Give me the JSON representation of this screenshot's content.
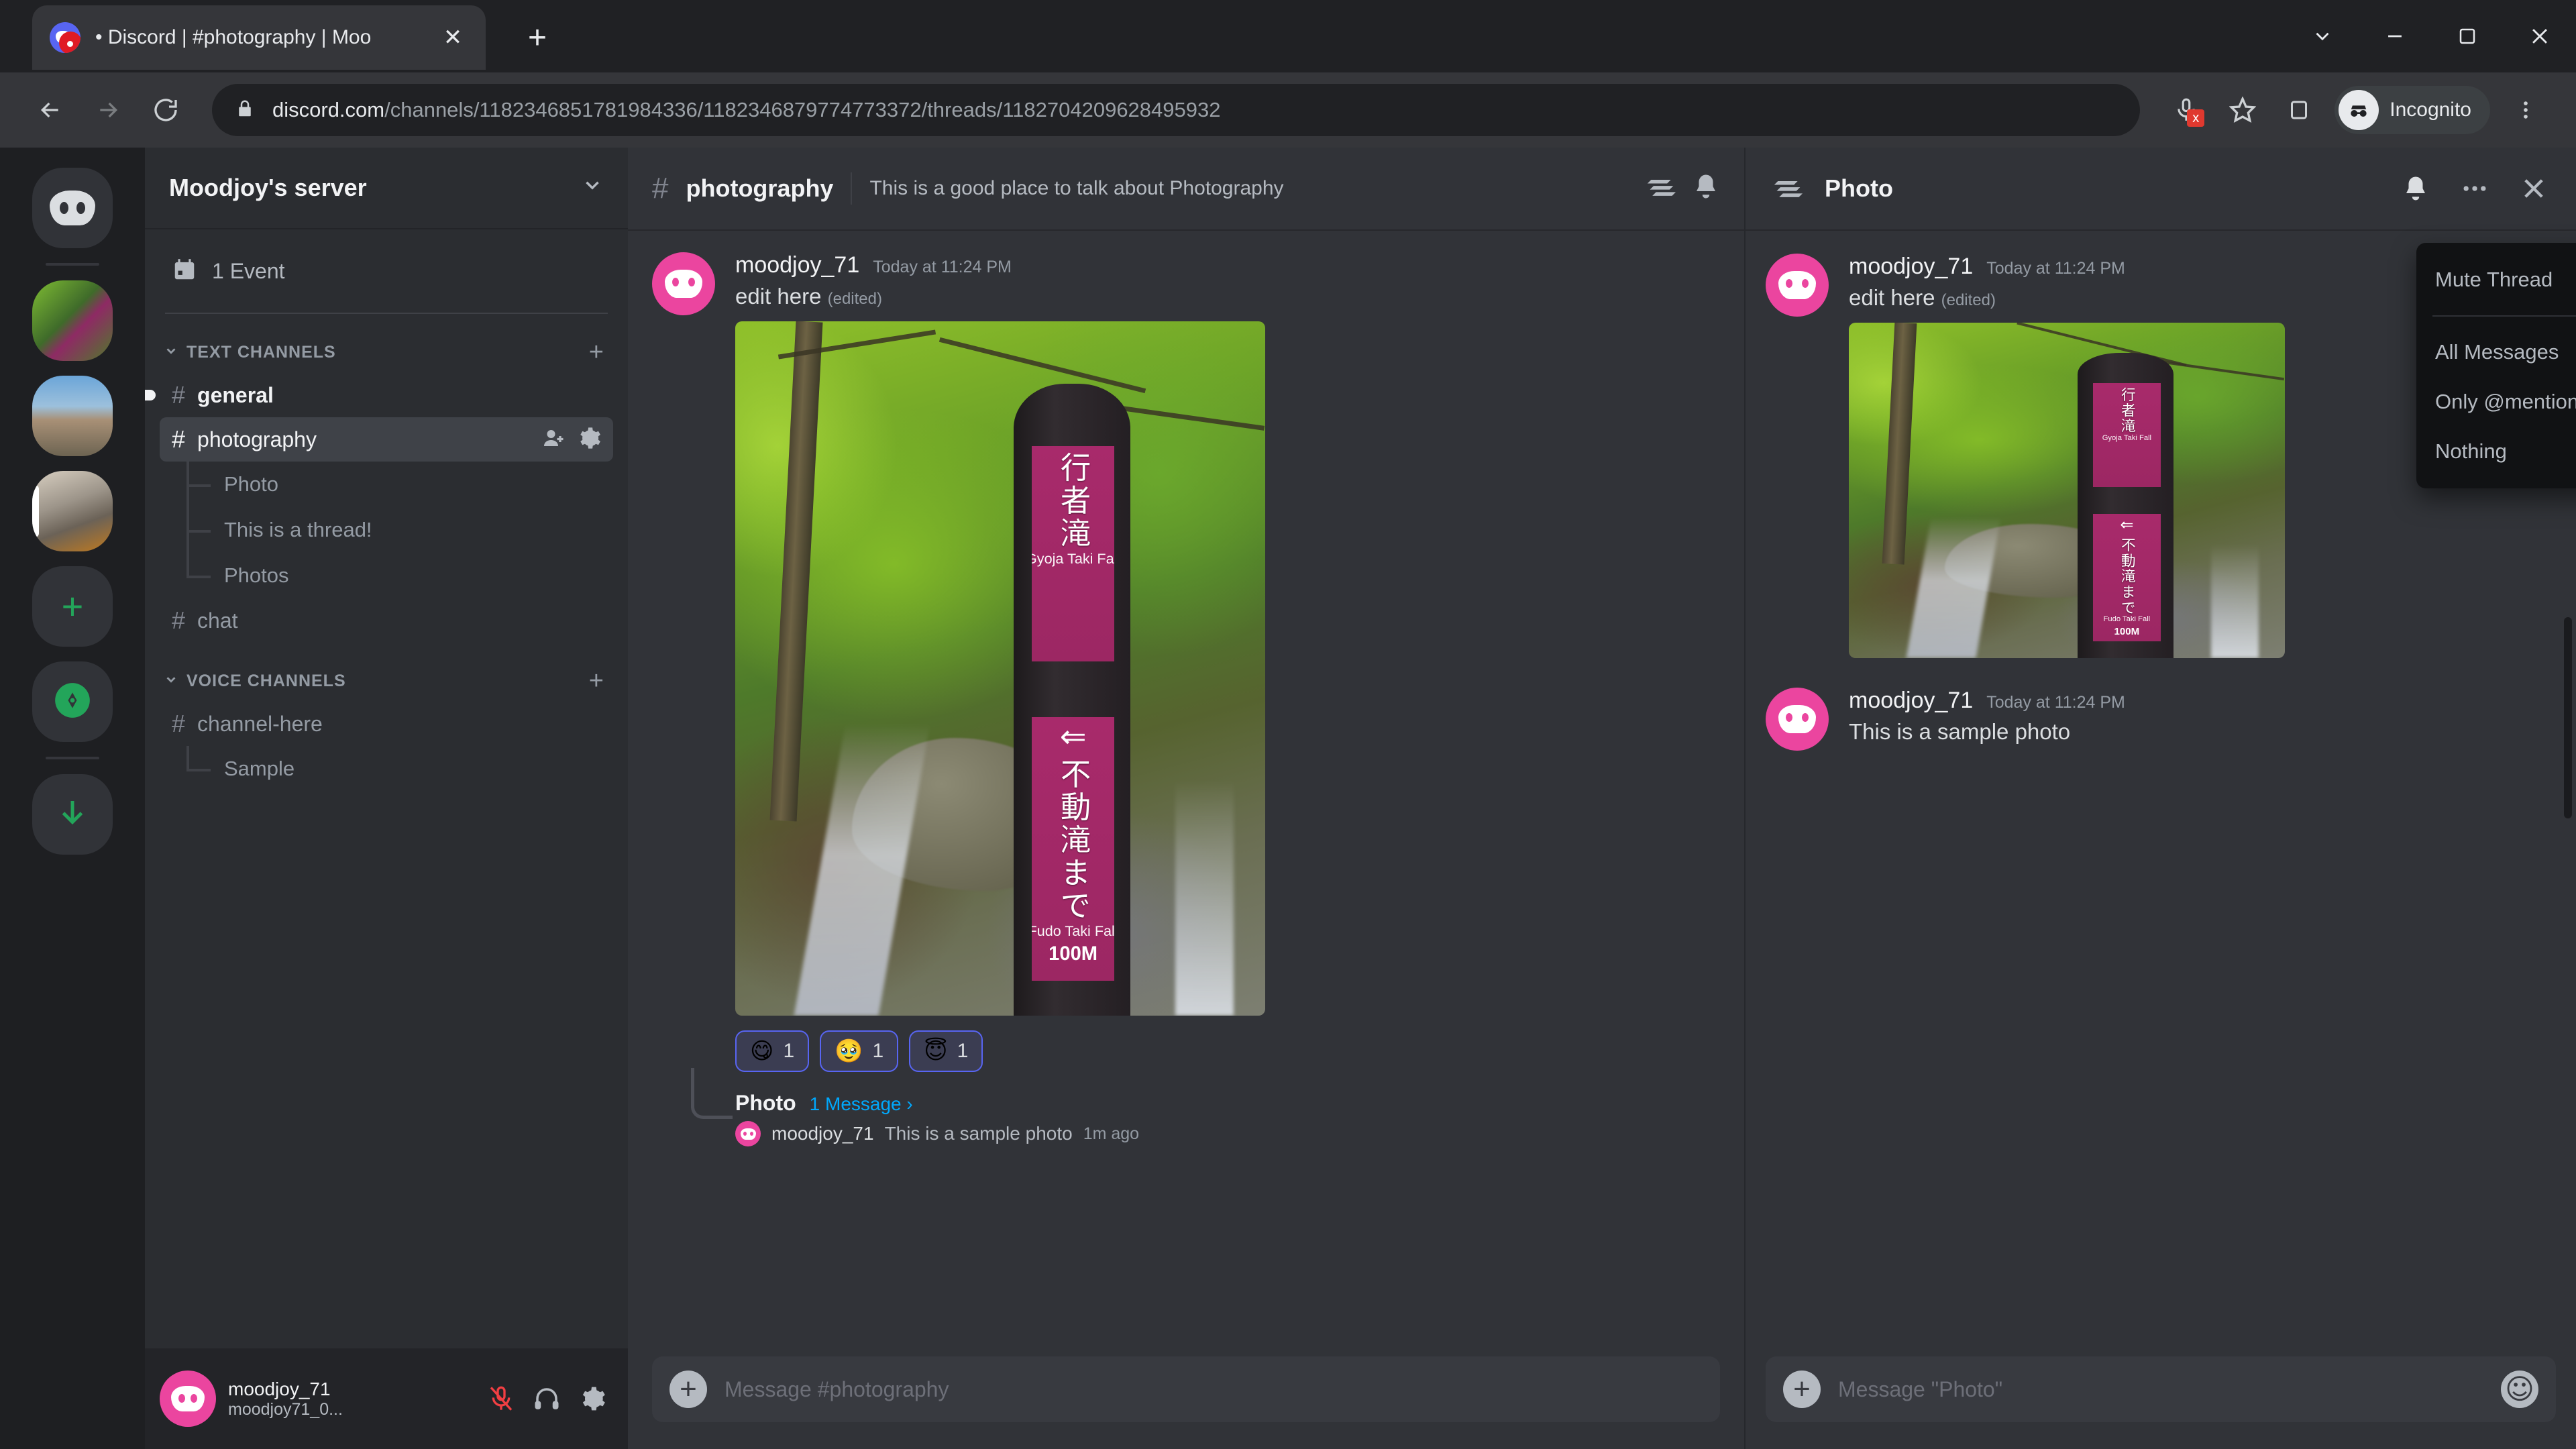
{
  "browser": {
    "tab": {
      "title": "• Discord | #photography | Moo",
      "close_label": "✕",
      "favicon": "discord-favicon"
    },
    "new_tab_label": "+",
    "window": {
      "minimize": "minimize-icon",
      "maximize": "maximize-icon",
      "close": "close-icon",
      "chevron": "chevron-down-icon"
    },
    "nav": {
      "back": "back-arrow-icon",
      "forward": "forward-arrow-icon",
      "reload": "reload-icon"
    },
    "omnibox": {
      "lock": "lock-icon",
      "domain": "discord.com",
      "path": "/channels/1182346851781984336/1182346879774773372/threads/1182704209628495932"
    },
    "toolbar_right": {
      "mic_blocked": "microphone-blocked-icon",
      "mic_badge": "x",
      "bookmark": "star-icon",
      "side_panel": "side-panel-icon",
      "incognito_label": "Incognito",
      "menu": "three-dot-menu-icon"
    }
  },
  "rail": {
    "home_tooltip": "discord-home-icon",
    "items": [
      {
        "name": "server-avatar-1"
      },
      {
        "name": "server-avatar-2"
      },
      {
        "name": "server-avatar-3"
      }
    ],
    "add_server": "+",
    "explore": "compass-icon",
    "download": "download-arrow-icon"
  },
  "sidebar": {
    "server_name": "Moodjoy's server",
    "server_dropdown": "chevron-down-icon",
    "event": {
      "label": "1 Event",
      "icon": "calendar-icon"
    },
    "categories": [
      {
        "label": "TEXT CHANNELS",
        "add_label": "+",
        "channels": [
          {
            "name": "general",
            "type": "text",
            "unread": true
          },
          {
            "name": "photography",
            "type": "text",
            "active": true,
            "threads": [
              "Photo",
              "This is a thread!",
              "Photos"
            ]
          },
          {
            "name": "chat",
            "type": "text"
          }
        ]
      },
      {
        "label": "VOICE CHANNELS",
        "add_label": "+",
        "channels": [
          {
            "name": "channel-here",
            "type": "text",
            "threads": [
              "Sample"
            ]
          }
        ]
      }
    ],
    "user": {
      "name": "moodjoy_71",
      "tag": "moodjoy71_0...",
      "mic": "microphone-muted-icon",
      "headset": "headphones-icon",
      "settings": "gear-icon"
    }
  },
  "channel": {
    "hash": "#",
    "name": "photography",
    "topic": "This is a good place to talk about Photography",
    "header_icons": [
      "threads-icon",
      "bell-icon"
    ],
    "message": {
      "author": "moodjoy_71",
      "timestamp": "Today at 11:24 PM",
      "text": "edit here",
      "edited_label": "(edited)",
      "attachment": {
        "alt": "forest-trail-signpost-photo",
        "sign_top_kanji": "行者滝",
        "sign_top_romaji": "Gyoja Taki Fall",
        "sign_bottom_arrow": "⇐",
        "sign_bottom_kanji": "不動滝まで",
        "sign_bottom_romaji": "Fudo Taki Fall",
        "sign_bottom_distance": "100M"
      },
      "reactions": [
        {
          "emoji": "😋",
          "count": "1"
        },
        {
          "emoji": "🥹",
          "count": "1"
        },
        {
          "emoji": "😇",
          "count": "1"
        }
      ],
      "thread_preview": {
        "name": "Photo",
        "count": "1 Message",
        "chevron": "›",
        "author": "moodjoy_71",
        "text": "This is a sample photo",
        "time": "1m ago"
      }
    },
    "composer": {
      "placeholder": "Message #photography",
      "add": "+"
    }
  },
  "thread_panel": {
    "icon": "threads-icon",
    "title": "Photo",
    "header_icons": {
      "bell": "bell-icon",
      "more": "more-horizontal-icon",
      "close": "close-icon"
    },
    "messages": [
      {
        "author": "moodjoy_71",
        "timestamp": "Today at 11:24 PM",
        "text": "edit here",
        "edited_label": "(edited)",
        "has_attachment": true
      },
      {
        "author": "moodjoy_71",
        "timestamp": "Today at 11:24 PM",
        "text": "This is a sample photo",
        "has_attachment": false
      }
    ],
    "composer": {
      "placeholder": "Message \"Photo\"",
      "add": "+",
      "emoji": "emoji-icon"
    }
  },
  "context_menu": {
    "mute": {
      "label": "Mute Thread",
      "arrow": "›"
    },
    "options": [
      {
        "label": "All Messages",
        "selected": true
      },
      {
        "label": "Only @mentions",
        "selected": false
      },
      {
        "label": "Nothing",
        "selected": false
      }
    ]
  },
  "colors": {
    "accent": "#5865f2",
    "avatar": "#eb459f",
    "link": "#00a8fc",
    "green": "#23a55a"
  }
}
